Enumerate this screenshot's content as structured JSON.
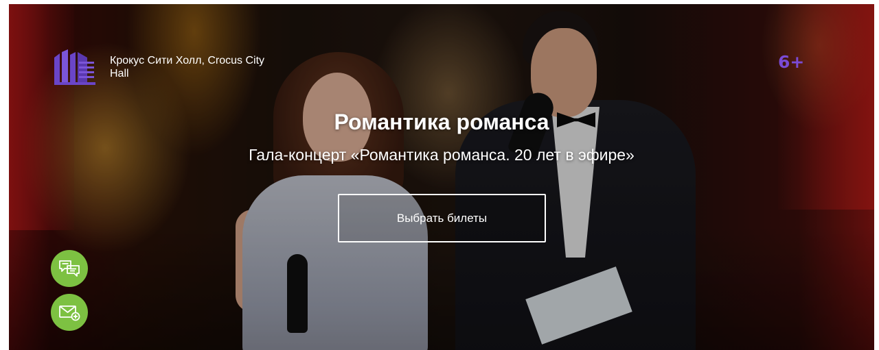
{
  "venue": {
    "name": "Крокус Сити Холл, Crocus City Hall",
    "logo_icon": "building-logo-icon",
    "logo_color": "#6a45c8"
  },
  "age_rating": "6+",
  "event": {
    "title": "Романтика романса",
    "subtitle": "Гала-концерт «Романтика романса. 20 лет в эфире»"
  },
  "cta": {
    "label": "Выбрать билеты"
  },
  "floating_buttons": [
    {
      "icon": "chat-bubbles-icon",
      "color": "#7dc142"
    },
    {
      "icon": "mail-add-icon",
      "color": "#7dc142"
    }
  ],
  "colors": {
    "accent_purple": "#7a4bd6",
    "accent_green": "#7dc142"
  }
}
